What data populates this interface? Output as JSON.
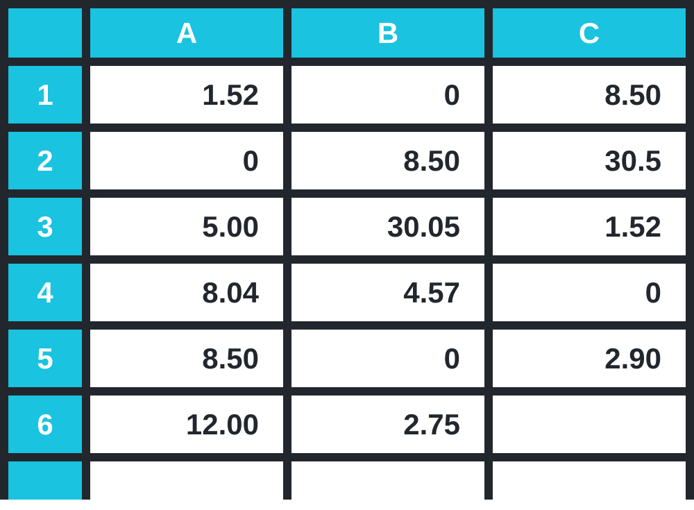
{
  "chart_data": {
    "type": "table",
    "columns": [
      "A",
      "B",
      "C"
    ],
    "rows": [
      "1",
      "2",
      "3",
      "4",
      "5",
      "6"
    ],
    "data": [
      [
        "1.52",
        "0",
        "8.50"
      ],
      [
        "0",
        "8.50",
        "30.5"
      ],
      [
        "5.00",
        "30.05",
        "1.52"
      ],
      [
        "8.04",
        "4.57",
        "0"
      ],
      [
        "8.50",
        "0",
        "2.90"
      ],
      [
        "12.00",
        "2.75",
        ""
      ]
    ]
  },
  "headers": {
    "corner": "",
    "colA": "A",
    "colB": "B",
    "colC": "C"
  },
  "row_labels": {
    "r1": "1",
    "r2": "2",
    "r3": "3",
    "r4": "4",
    "r5": "5",
    "r6": "6",
    "r7": ""
  },
  "cells": {
    "A1": "1.52",
    "B1": "0",
    "C1": "8.50",
    "A2": "0",
    "B2": "8.50",
    "C2": "30.5",
    "A3": "5.00",
    "B3": "30.05",
    "C3": "1.52",
    "A4": "8.04",
    "B4": "4.57",
    "C4": "0",
    "A5": "8.50",
    "B5": "0",
    "C5": "2.90",
    "A6": "12.00",
    "B6": "2.75",
    "C6": "",
    "A7": "",
    "B7": "",
    "C7": ""
  }
}
